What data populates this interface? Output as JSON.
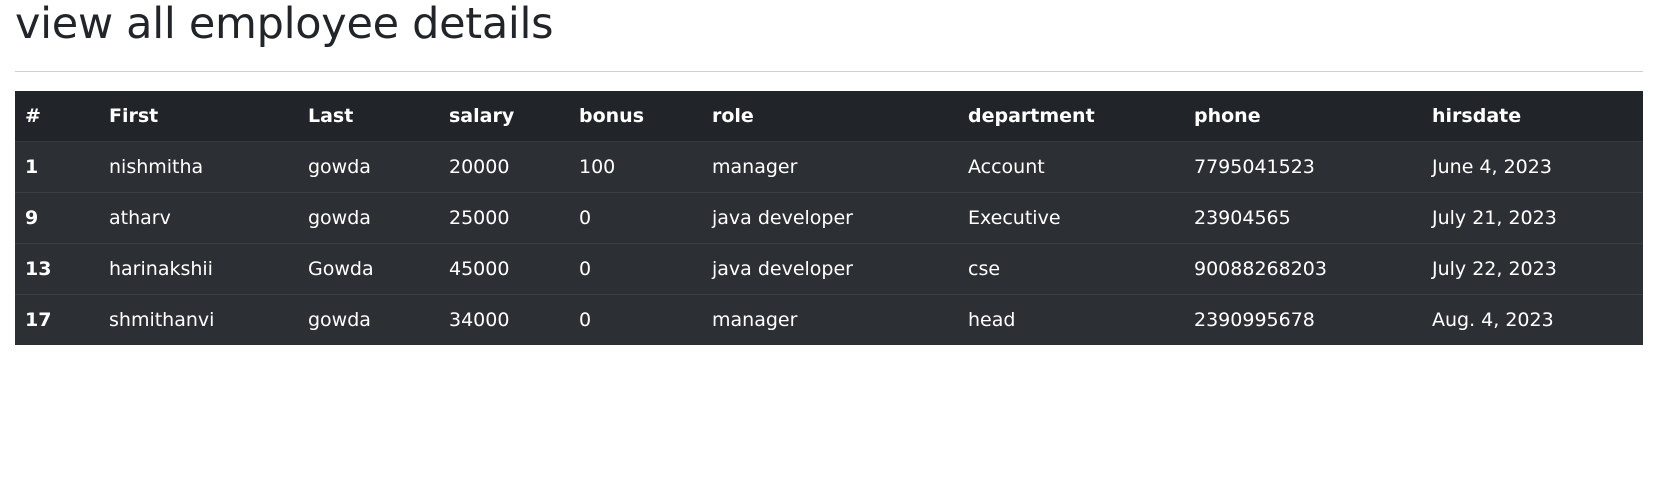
{
  "page": {
    "title": "view all employee details"
  },
  "table": {
    "columns": [
      "#",
      "First",
      "Last",
      "salary",
      "bonus",
      "role",
      "department",
      "phone",
      "hirsdate"
    ],
    "rows": [
      [
        "1",
        "nishmitha",
        "gowda",
        "20000",
        "100",
        "manager",
        "Account",
        "7795041523",
        "June 4, 2023"
      ],
      [
        "9",
        "atharv",
        "gowda",
        "25000",
        "0",
        "java developer",
        "Executive",
        "23904565",
        "July 21, 2023"
      ],
      [
        "13",
        "harinakshii",
        "Gowda",
        "45000",
        "0",
        "java developer",
        "cse",
        "90088268203",
        "July 22, 2023"
      ],
      [
        "17",
        "shmithanvi",
        "gowda",
        "34000",
        "0",
        "manager",
        "head",
        "2390995678",
        "Aug. 4, 2023"
      ]
    ]
  },
  "colors": {
    "header_bg": "#212529",
    "row_bg": "#2c3034",
    "text": "#ffffff",
    "title_text": "#212529"
  }
}
